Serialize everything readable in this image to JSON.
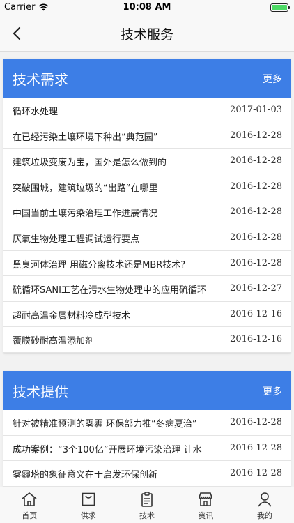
{
  "status_bar": {
    "carrier": "Carrier",
    "time": "10:08 AM"
  },
  "nav": {
    "title": "技术服务",
    "back_icon": "chevron-left-icon"
  },
  "demand": {
    "title": "技术需求",
    "more": "更多",
    "items": [
      {
        "title": "循环水处理",
        "date": "2017-01-03"
      },
      {
        "title": "在已经污染土壤环境下种出“典范园”",
        "date": "2016-12-28"
      },
      {
        "title": "建筑垃圾变废为宝，国外是怎么做到的",
        "date": "2016-12-28"
      },
      {
        "title": "突破围城，建筑垃圾的“出路”在哪里",
        "date": "2016-12-28"
      },
      {
        "title": "中国当前土壤污染治理工作进展情况",
        "date": "2016-12-28"
      },
      {
        "title": "厌氧生物处理工程调试运行要点",
        "date": "2016-12-28"
      },
      {
        "title": "黑臭河体治理 用磁分离技术还是MBR技术?",
        "date": "2016-12-28"
      },
      {
        "title": "硫循环SANI工艺在污水生物处理中的应用硫循环",
        "date": "2016-12-27"
      },
      {
        "title": "超耐高温金属材料冷成型技术",
        "date": "2016-12-16"
      },
      {
        "title": "覆膜砂耐高温添加剂",
        "date": "2016-12-16"
      }
    ]
  },
  "supply": {
    "title": "技术提供",
    "more": "更多",
    "items": [
      {
        "title": "针对被精准预测的雾霾 环保部力推“冬病夏治”",
        "date": "2016-12-28"
      },
      {
        "title": "成功案例：“3个100亿”开展环境污染治理 让水",
        "date": "2016-12-28"
      },
      {
        "title": "雾霾塔的象征意义在于启发环保创新",
        "date": "2016-12-28"
      }
    ]
  },
  "tabs": [
    {
      "label": "首页",
      "icon": "home-icon"
    },
    {
      "label": "供求",
      "icon": "shopping-bag-icon"
    },
    {
      "label": "技术",
      "icon": "clipboard-icon"
    },
    {
      "label": "资讯",
      "icon": "store-icon"
    },
    {
      "label": "我的",
      "icon": "user-icon"
    }
  ],
  "colors": {
    "accent": "#3d7ee6",
    "battery": "#4cd964"
  }
}
